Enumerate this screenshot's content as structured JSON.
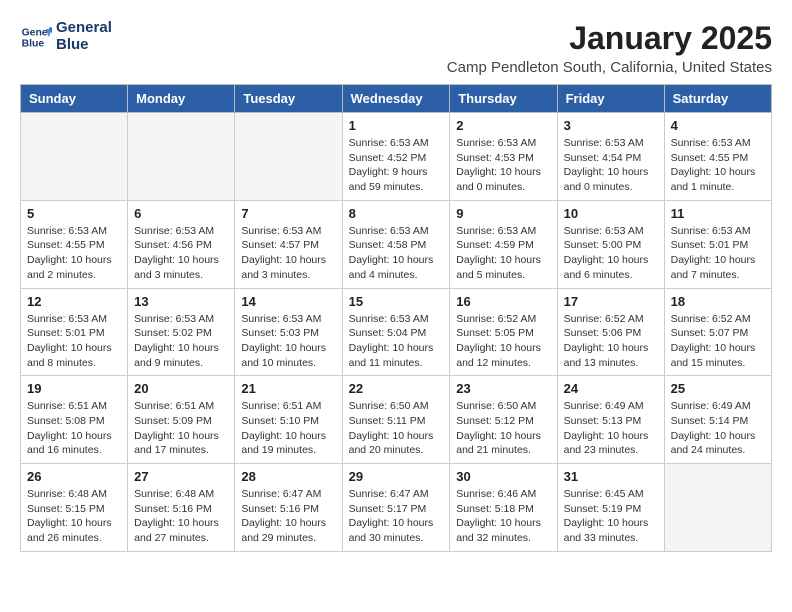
{
  "header": {
    "logo_line1": "General",
    "logo_line2": "Blue",
    "month_title": "January 2025",
    "location": "Camp Pendleton South, California, United States"
  },
  "days_of_week": [
    "Sunday",
    "Monday",
    "Tuesday",
    "Wednesday",
    "Thursday",
    "Friday",
    "Saturday"
  ],
  "weeks": [
    [
      {
        "day": "",
        "empty": true
      },
      {
        "day": "",
        "empty": true
      },
      {
        "day": "",
        "empty": true
      },
      {
        "day": "1",
        "sunrise": "6:53 AM",
        "sunset": "4:52 PM",
        "daylight": "9 hours and 59 minutes."
      },
      {
        "day": "2",
        "sunrise": "6:53 AM",
        "sunset": "4:53 PM",
        "daylight": "10 hours and 0 minutes."
      },
      {
        "day": "3",
        "sunrise": "6:53 AM",
        "sunset": "4:54 PM",
        "daylight": "10 hours and 0 minutes."
      },
      {
        "day": "4",
        "sunrise": "6:53 AM",
        "sunset": "4:55 PM",
        "daylight": "10 hours and 1 minute."
      }
    ],
    [
      {
        "day": "5",
        "sunrise": "6:53 AM",
        "sunset": "4:55 PM",
        "daylight": "10 hours and 2 minutes."
      },
      {
        "day": "6",
        "sunrise": "6:53 AM",
        "sunset": "4:56 PM",
        "daylight": "10 hours and 3 minutes."
      },
      {
        "day": "7",
        "sunrise": "6:53 AM",
        "sunset": "4:57 PM",
        "daylight": "10 hours and 3 minutes."
      },
      {
        "day": "8",
        "sunrise": "6:53 AM",
        "sunset": "4:58 PM",
        "daylight": "10 hours and 4 minutes."
      },
      {
        "day": "9",
        "sunrise": "6:53 AM",
        "sunset": "4:59 PM",
        "daylight": "10 hours and 5 minutes."
      },
      {
        "day": "10",
        "sunrise": "6:53 AM",
        "sunset": "5:00 PM",
        "daylight": "10 hours and 6 minutes."
      },
      {
        "day": "11",
        "sunrise": "6:53 AM",
        "sunset": "5:01 PM",
        "daylight": "10 hours and 7 minutes."
      }
    ],
    [
      {
        "day": "12",
        "sunrise": "6:53 AM",
        "sunset": "5:01 PM",
        "daylight": "10 hours and 8 minutes."
      },
      {
        "day": "13",
        "sunrise": "6:53 AM",
        "sunset": "5:02 PM",
        "daylight": "10 hours and 9 minutes."
      },
      {
        "day": "14",
        "sunrise": "6:53 AM",
        "sunset": "5:03 PM",
        "daylight": "10 hours and 10 minutes."
      },
      {
        "day": "15",
        "sunrise": "6:53 AM",
        "sunset": "5:04 PM",
        "daylight": "10 hours and 11 minutes."
      },
      {
        "day": "16",
        "sunrise": "6:52 AM",
        "sunset": "5:05 PM",
        "daylight": "10 hours and 12 minutes."
      },
      {
        "day": "17",
        "sunrise": "6:52 AM",
        "sunset": "5:06 PM",
        "daylight": "10 hours and 13 minutes."
      },
      {
        "day": "18",
        "sunrise": "6:52 AM",
        "sunset": "5:07 PM",
        "daylight": "10 hours and 15 minutes."
      }
    ],
    [
      {
        "day": "19",
        "sunrise": "6:51 AM",
        "sunset": "5:08 PM",
        "daylight": "10 hours and 16 minutes."
      },
      {
        "day": "20",
        "sunrise": "6:51 AM",
        "sunset": "5:09 PM",
        "daylight": "10 hours and 17 minutes."
      },
      {
        "day": "21",
        "sunrise": "6:51 AM",
        "sunset": "5:10 PM",
        "daylight": "10 hours and 19 minutes."
      },
      {
        "day": "22",
        "sunrise": "6:50 AM",
        "sunset": "5:11 PM",
        "daylight": "10 hours and 20 minutes."
      },
      {
        "day": "23",
        "sunrise": "6:50 AM",
        "sunset": "5:12 PM",
        "daylight": "10 hours and 21 minutes."
      },
      {
        "day": "24",
        "sunrise": "6:49 AM",
        "sunset": "5:13 PM",
        "daylight": "10 hours and 23 minutes."
      },
      {
        "day": "25",
        "sunrise": "6:49 AM",
        "sunset": "5:14 PM",
        "daylight": "10 hours and 24 minutes."
      }
    ],
    [
      {
        "day": "26",
        "sunrise": "6:48 AM",
        "sunset": "5:15 PM",
        "daylight": "10 hours and 26 minutes."
      },
      {
        "day": "27",
        "sunrise": "6:48 AM",
        "sunset": "5:16 PM",
        "daylight": "10 hours and 27 minutes."
      },
      {
        "day": "28",
        "sunrise": "6:47 AM",
        "sunset": "5:16 PM",
        "daylight": "10 hours and 29 minutes."
      },
      {
        "day": "29",
        "sunrise": "6:47 AM",
        "sunset": "5:17 PM",
        "daylight": "10 hours and 30 minutes."
      },
      {
        "day": "30",
        "sunrise": "6:46 AM",
        "sunset": "5:18 PM",
        "daylight": "10 hours and 32 minutes."
      },
      {
        "day": "31",
        "sunrise": "6:45 AM",
        "sunset": "5:19 PM",
        "daylight": "10 hours and 33 minutes."
      },
      {
        "day": "",
        "empty": true
      }
    ]
  ],
  "labels": {
    "sunrise": "Sunrise:",
    "sunset": "Sunset:",
    "daylight": "Daylight:"
  }
}
